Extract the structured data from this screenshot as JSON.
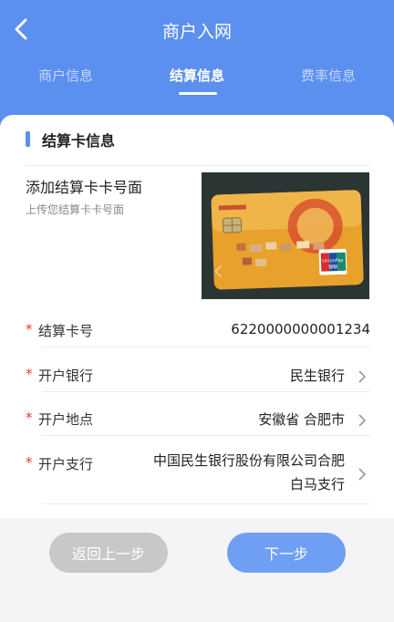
{
  "header": {
    "title": "商户入网",
    "tabs": [
      {
        "label": "商户信息",
        "active": false
      },
      {
        "label": "结算信息",
        "active": true
      },
      {
        "label": "费率信息",
        "active": false
      }
    ],
    "back_icon": "chevron-left-icon"
  },
  "section": {
    "title": "结算卡信息"
  },
  "upload": {
    "title": "添加结算卡卡号面",
    "subtitle": "上传您结算卡卡号面",
    "card_brand": "UnionPay",
    "card_brand_cn": "银联"
  },
  "fields": [
    {
      "label": "结算卡号",
      "value": "6220000000001234",
      "required": true,
      "has_arrow": false
    },
    {
      "label": "开户银行",
      "value": "民生银行",
      "required": true,
      "has_arrow": true
    },
    {
      "label": "开户地点",
      "value": "安徽省 合肥市",
      "required": true,
      "has_arrow": true
    },
    {
      "label": "开户支行",
      "value_line1": "中国民生银行股份有限公司合肥",
      "value_line2": "白马支行",
      "required": true,
      "has_arrow": true
    }
  ],
  "footer": {
    "prev_label": "返回上一步",
    "next_label": "下一步"
  },
  "colors": {
    "primary": "#5b8ff0",
    "required": "#e53935",
    "disabled_button": "#c8c8c8",
    "next_button": "#6f9ff2"
  }
}
